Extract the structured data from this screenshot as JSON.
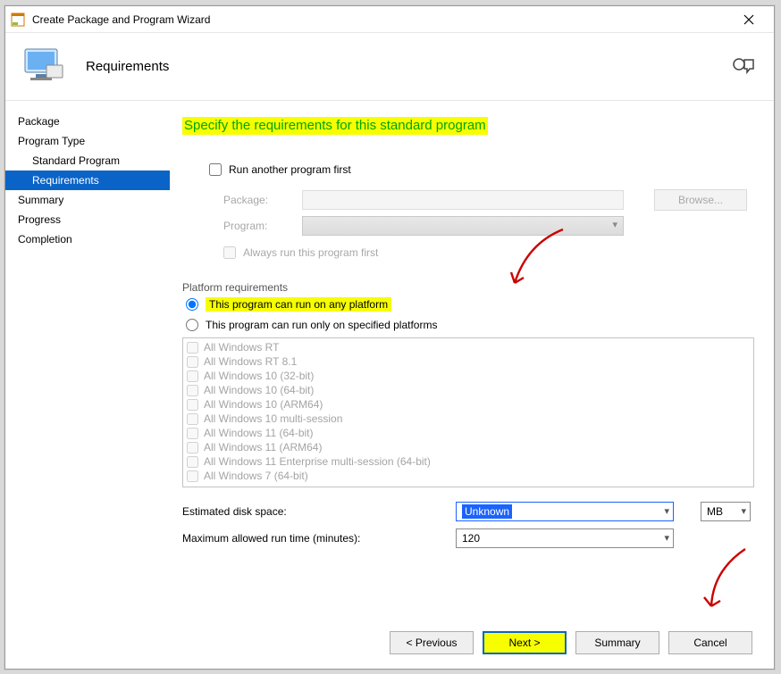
{
  "title": "Create Package and Program Wizard",
  "header": {
    "label": "Requirements"
  },
  "sidebar": {
    "items": [
      {
        "label": "Package",
        "indent": 0,
        "selected": false
      },
      {
        "label": "Program Type",
        "indent": 0,
        "selected": false
      },
      {
        "label": "Standard Program",
        "indent": 1,
        "selected": false
      },
      {
        "label": "Requirements",
        "indent": 1,
        "selected": true
      },
      {
        "label": "Summary",
        "indent": 0,
        "selected": false
      },
      {
        "label": "Progress",
        "indent": 0,
        "selected": false
      },
      {
        "label": "Completion",
        "indent": 0,
        "selected": false
      }
    ]
  },
  "main": {
    "heading": "Specify the requirements for this standard program",
    "run_first_label": "Run another program first",
    "package_label": "Package:",
    "program_label": "Program:",
    "browse_label": "Browse...",
    "always_run_label": "Always run this program first",
    "platform_group": "Platform requirements",
    "radio_any": "This program can run on any platform",
    "radio_spec": "This program can run only on specified platforms",
    "platforms": [
      "All Windows RT",
      "All Windows RT 8.1",
      "All Windows 10 (32-bit)",
      "All Windows 10 (64-bit)",
      "All Windows 10 (ARM64)",
      "All Windows 10 multi-session",
      "All Windows 11 (64-bit)",
      "All Windows 11 (ARM64)",
      "All Windows 11 Enterprise multi-session (64-bit)",
      "All Windows 7 (64-bit)"
    ],
    "disk_label": "Estimated disk space:",
    "disk_value": "Unknown",
    "disk_unit": "MB",
    "runtime_label": "Maximum allowed run time (minutes):",
    "runtime_value": "120"
  },
  "buttons": {
    "prev": "<  Previous",
    "next": "Next  >",
    "summary": "Summary",
    "cancel": "Cancel"
  }
}
